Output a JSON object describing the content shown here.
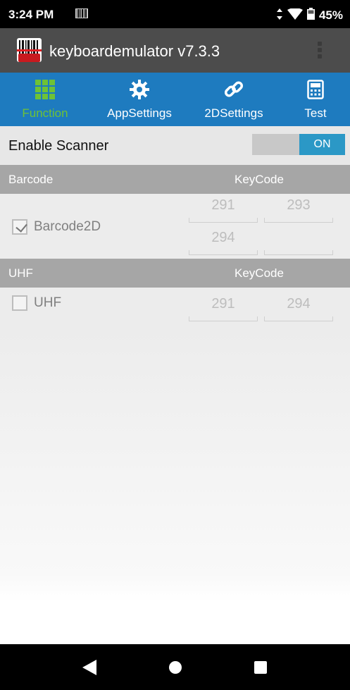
{
  "status_bar": {
    "time": "3:24 PM",
    "battery": "45%"
  },
  "app_bar": {
    "title": "keyboardemulator v7.3.3"
  },
  "tabs": [
    {
      "label": "Function",
      "icon": "grid-icon",
      "active": true
    },
    {
      "label": "AppSettings",
      "icon": "gear-icon",
      "active": false
    },
    {
      "label": "2DSettings",
      "icon": "link-icon",
      "active": false
    },
    {
      "label": "Test",
      "icon": "calculator-icon",
      "active": false
    }
  ],
  "enable_scanner": {
    "label": "Enable Scanner",
    "toggle_label": "ON",
    "state": true
  },
  "barcode_section": {
    "header_left": "Barcode",
    "header_right": "KeyCode",
    "item": {
      "label": "Barcode2D",
      "checked": true,
      "keycodes": [
        "291",
        "293",
        "294",
        ""
      ]
    }
  },
  "uhf_section": {
    "header_left": "UHF",
    "header_right": "KeyCode",
    "item": {
      "label": "UHF",
      "checked": false,
      "keycodes": [
        "291",
        "294"
      ]
    }
  },
  "colors": {
    "tab_bar": "#1e7bbf",
    "active_tab": "#6ec236",
    "toggle_on": "#2b98c6",
    "app_bar": "#4c4c4c",
    "section_header": "#a6a6a6"
  }
}
